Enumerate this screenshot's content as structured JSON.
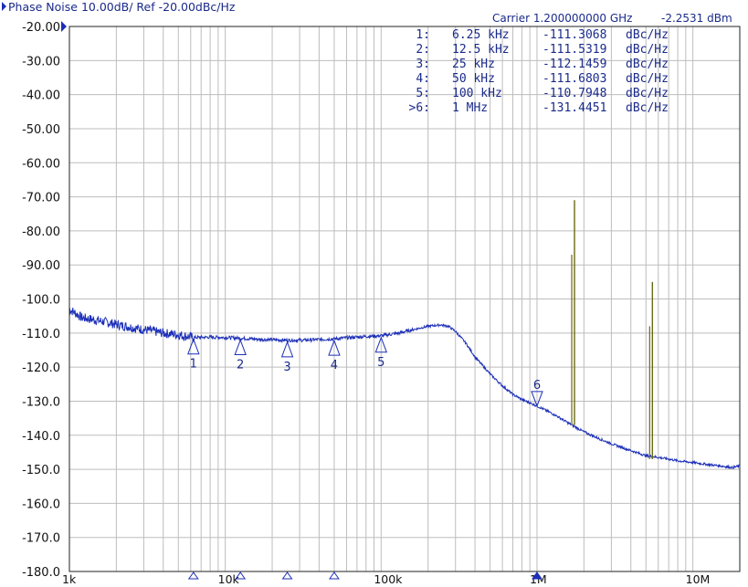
{
  "header": {
    "title": "Phase Noise 10.00dB/ Ref -20.00dBc/Hz",
    "carrier_label": "Carrier 1.200000000 GHz",
    "carrier_power": "-2.2531 dBm"
  },
  "marker_table": [
    {
      "id": "1:",
      "freq": "6.25 kHz",
      "value": "-111.3068",
      "unit": "dBc/Hz"
    },
    {
      "id": "2:",
      "freq": "12.5 kHz",
      "value": "-111.5319",
      "unit": "dBc/Hz"
    },
    {
      "id": "3:",
      "freq": "25 kHz",
      "value": "-112.1459",
      "unit": "dBc/Hz"
    },
    {
      "id": "4:",
      "freq": "50 kHz",
      "value": "-111.6803",
      "unit": "dBc/Hz"
    },
    {
      "id": "5:",
      "freq": "100 kHz",
      "value": "-110.7948",
      "unit": "dBc/Hz"
    },
    {
      "id": ">6:",
      "freq": "1 MHz",
      "value": "-131.4451",
      "unit": "dBc/Hz"
    }
  ],
  "colors": {
    "trace": "#1c2fb8",
    "spur": "#6b6a14",
    "grid": "#bdbdbd",
    "text": "#1a2a8a",
    "axis_text": "#111111"
  },
  "chart_data": {
    "type": "line",
    "x_scale": "log",
    "xlim": [
      1000,
      20000000
    ],
    "ylim": [
      -180,
      -20
    ],
    "ylabel": "dBc/Hz",
    "grid": true,
    "ytick_labels": [
      "-20.00",
      "-30.00",
      "-40.00",
      "-50.00",
      "-60.00",
      "-70.00",
      "-80.00",
      "-90.00",
      "-100.0",
      "-110.0",
      "-120.0",
      "-130.0",
      "-140.0",
      "-150.0",
      "-160.0",
      "-170.0",
      "-180.0"
    ],
    "xticks": [
      {
        "value": 1000,
        "label": "1k"
      },
      {
        "value": 10000,
        "label": "10k"
      },
      {
        "value": 100000,
        "label": "100k"
      },
      {
        "value": 1000000,
        "label": "1M"
      },
      {
        "value": 10000000,
        "label": "10M"
      }
    ],
    "series": [
      {
        "x": [
          1000,
          1080,
          1200,
          1400,
          1600,
          1800,
          2000,
          2300,
          2600,
          3000,
          3500,
          4000,
          5000,
          6250,
          8000,
          10000,
          12500,
          16000,
          20000,
          25000,
          32000,
          40000,
          50000,
          63000,
          80000,
          100000,
          130000,
          160000,
          200000,
          240000,
          270000,
          300000,
          350000,
          400000,
          500000,
          600000,
          700000,
          800000,
          1000000,
          1300000,
          1600000,
          2000000,
          2500000,
          3000000,
          4000000,
          5000000,
          6000000,
          7000000,
          8000000,
          10000000,
          12000000,
          15000000,
          18000000,
          20000000
        ],
        "y": [
          -103,
          -104,
          -105.5,
          -106,
          -106.5,
          -107,
          -107.5,
          -108,
          -108.5,
          -109,
          -109.5,
          -110,
          -110.5,
          -111.3,
          -111.2,
          -111.3,
          -111.5,
          -111.8,
          -112,
          -112.1,
          -112.1,
          -111.9,
          -111.7,
          -111.3,
          -111,
          -110.8,
          -110,
          -109,
          -108,
          -107.6,
          -108,
          -109.5,
          -113,
          -117,
          -122,
          -125.5,
          -128,
          -129.5,
          -131.4,
          -134,
          -136.5,
          -139,
          -141,
          -142.5,
          -144.5,
          -146,
          -146.5,
          -147,
          -147.5,
          -148,
          -148.5,
          -149,
          -149.5,
          -149
        ]
      }
    ],
    "spurs": [
      {
        "x": 1740000,
        "y_base": -137,
        "y_peaks": [
          -71,
          -87
        ]
      },
      {
        "x": 5500000,
        "y_base": -147,
        "y_peaks": [
          -95,
          -108
        ]
      }
    ],
    "markers": [
      {
        "label": "1",
        "x": 6250,
        "y": -111.3068,
        "direction": "up"
      },
      {
        "label": "2",
        "x": 12500,
        "y": -111.5319,
        "direction": "up"
      },
      {
        "label": "3",
        "x": 25000,
        "y": -112.1459,
        "direction": "up"
      },
      {
        "label": "4",
        "x": 50000,
        "y": -111.6803,
        "direction": "up"
      },
      {
        "label": "5",
        "x": 100000,
        "y": -110.7948,
        "direction": "up"
      },
      {
        "label": "6",
        "x": 1000000,
        "y": -131.4451,
        "direction": "down"
      }
    ],
    "bottom_markers_x": [
      6250,
      12500,
      25000,
      50000,
      1000000
    ]
  }
}
